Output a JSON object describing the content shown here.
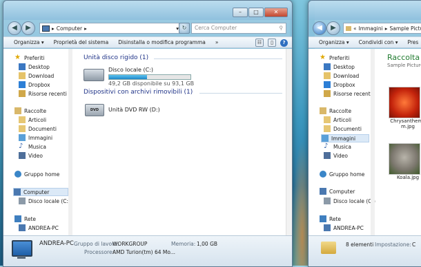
{
  "window1": {
    "address": [
      "Computer"
    ],
    "search_placeholder": "Cerca Computer",
    "toolbar": [
      "Organizza ▾",
      "Proprietà del sistema",
      "Disinstalla o modifica programma",
      "»"
    ],
    "nav": {
      "favorites_header": "Preferiti",
      "favorites": [
        "Desktop",
        "Download",
        "Dropbox",
        "Risorse recenti"
      ],
      "libraries_header": "Raccolte",
      "libraries": [
        "Articoli",
        "Documenti",
        "Immagini",
        "Musica",
        "Video"
      ],
      "homegroup": "Gruppo home",
      "computer_header": "Computer",
      "computer_items": [
        "Disco locale (C:)"
      ],
      "network_header": "Rete",
      "network_items": [
        "ANDREA-PC"
      ]
    },
    "sections": {
      "hdd": "Unità disco rigido (1)",
      "removable": "Dispositivi con archivi rimovibili (1)"
    },
    "drive_c": {
      "name": "Disco locale (C:)",
      "free_text": "49,2 GB disponibile su 93,1 GB",
      "used_fraction": 0.47
    },
    "dvd": {
      "name": "Unità DVD RW (D:)"
    },
    "status": {
      "pc_name": "ANDREA-PC",
      "workgroup_label": "Gruppo di lavoro:",
      "workgroup_value": "WORKGROUP",
      "memory_label": "Memoria:",
      "memory_value": "1,00 GB",
      "processor_label": "Processore:",
      "processor_value": "AMD Turion(tm) 64 Mo..."
    }
  },
  "window2": {
    "address": [
      "Immagini",
      "Sample Picture"
    ],
    "toolbar": [
      "Organizza ▾",
      "Condividi con ▾",
      "Pres"
    ],
    "nav": {
      "favorites_header": "Preferiti",
      "favorites": [
        "Desktop",
        "Download",
        "Dropbox",
        "Risorse recenti"
      ],
      "libraries_header": "Raccolte",
      "libraries": [
        "Articoli",
        "Documenti",
        "Immagini",
        "Musica",
        "Video"
      ],
      "homegroup": "Gruppo home",
      "computer_header": "Computer",
      "computer_items": [
        "Disco locale (C:)"
      ],
      "network_header": "Rete",
      "network_items": [
        "ANDREA-PC"
      ]
    },
    "library_title": "Raccolta I",
    "library_subtitle": "Sample Picture",
    "files": [
      "Chrysanthemum.jpg",
      "Koala.jpg"
    ],
    "status": {
      "count": "8 elementi",
      "label": "Impostazione:",
      "value": "C"
    }
  },
  "colors": {
    "accent": "#1e3287",
    "selection": "#dbe9f7",
    "drive_bar": "#1f86c8"
  }
}
